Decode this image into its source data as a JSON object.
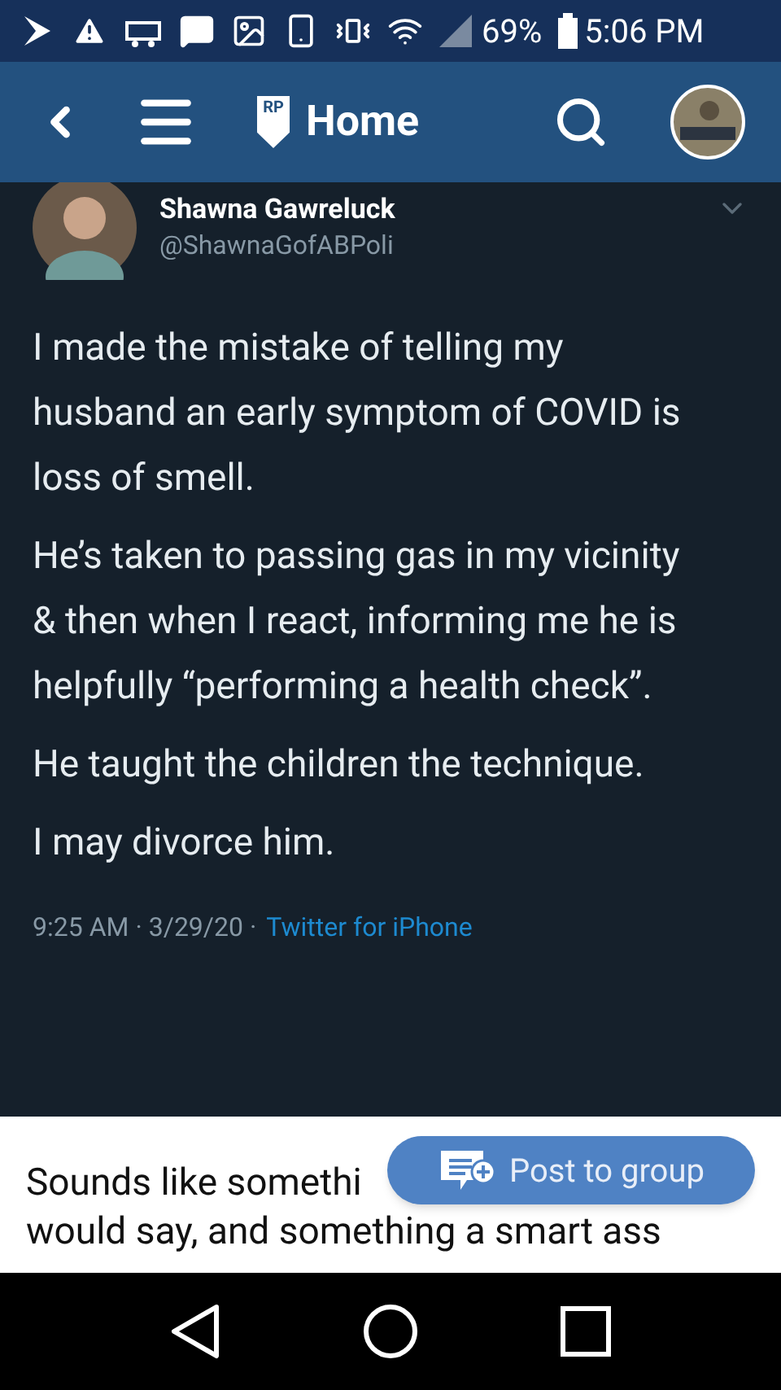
{
  "status_bar": {
    "battery": "69%",
    "time": "5:06 PM"
  },
  "app_bar": {
    "title": "Home",
    "logo": "RP"
  },
  "tweet": {
    "name": "Shawna Gawreluck",
    "handle": "@ShawnaGofABPoli",
    "paragraphs": [
      "I made the mistake of telling my husband an early symptom of COVID is loss of smell.",
      "He’s taken to passing gas in my vicinity & then when I react, informing me he is helpfully “performing a health check”.",
      "He taught the children the technique.",
      "I may divorce him."
    ],
    "meta": "9:25 AM · 3/29/20 ·",
    "source": "Twitter for iPhone"
  },
  "comment": {
    "lines": [
      "Sounds like somethi",
      "would say, and something a smart ass"
    ]
  },
  "fab": {
    "label": "Post to group"
  }
}
